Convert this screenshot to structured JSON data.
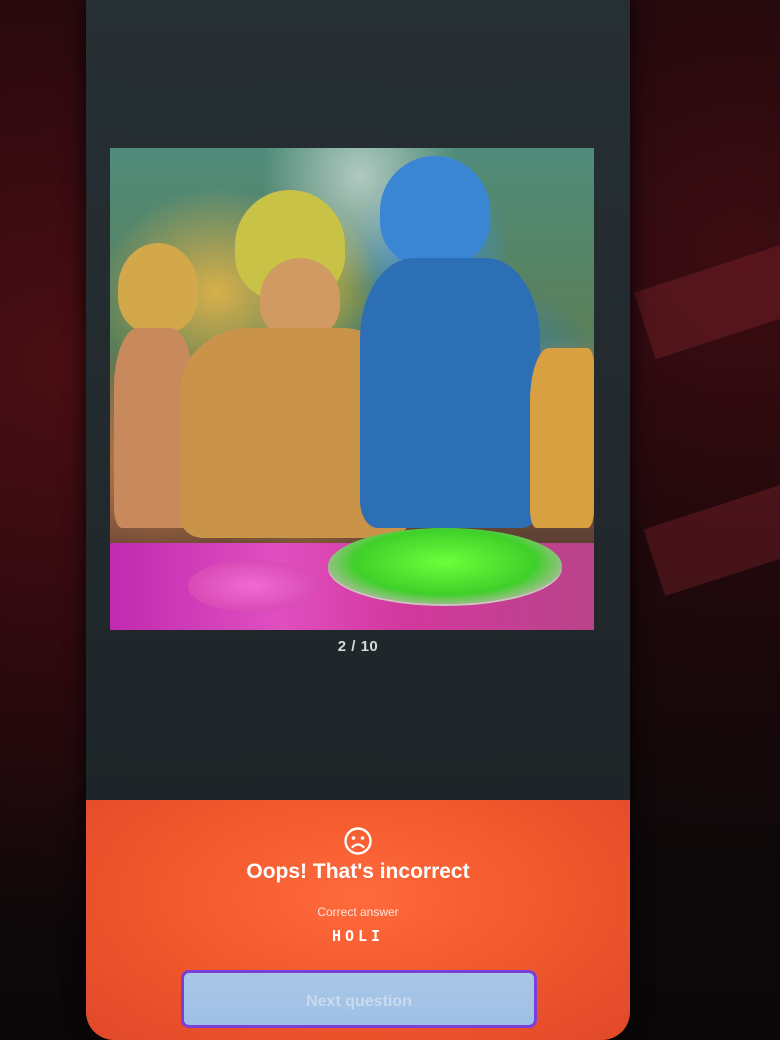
{
  "quiz": {
    "progress": "2 / 10",
    "current_question": 2,
    "total_questions": 10,
    "image_icon": "photo"
  },
  "result": {
    "icon": "sad-face-icon",
    "title": "Oops! That's incorrect",
    "answer_caption": "Correct answer",
    "answer_value": "HOLI",
    "next_label": "Next question"
  },
  "colors": {
    "result_background": "#f35a2d",
    "next_button_fill": "#a9c6e6",
    "next_button_border": "#7a3fd6"
  }
}
